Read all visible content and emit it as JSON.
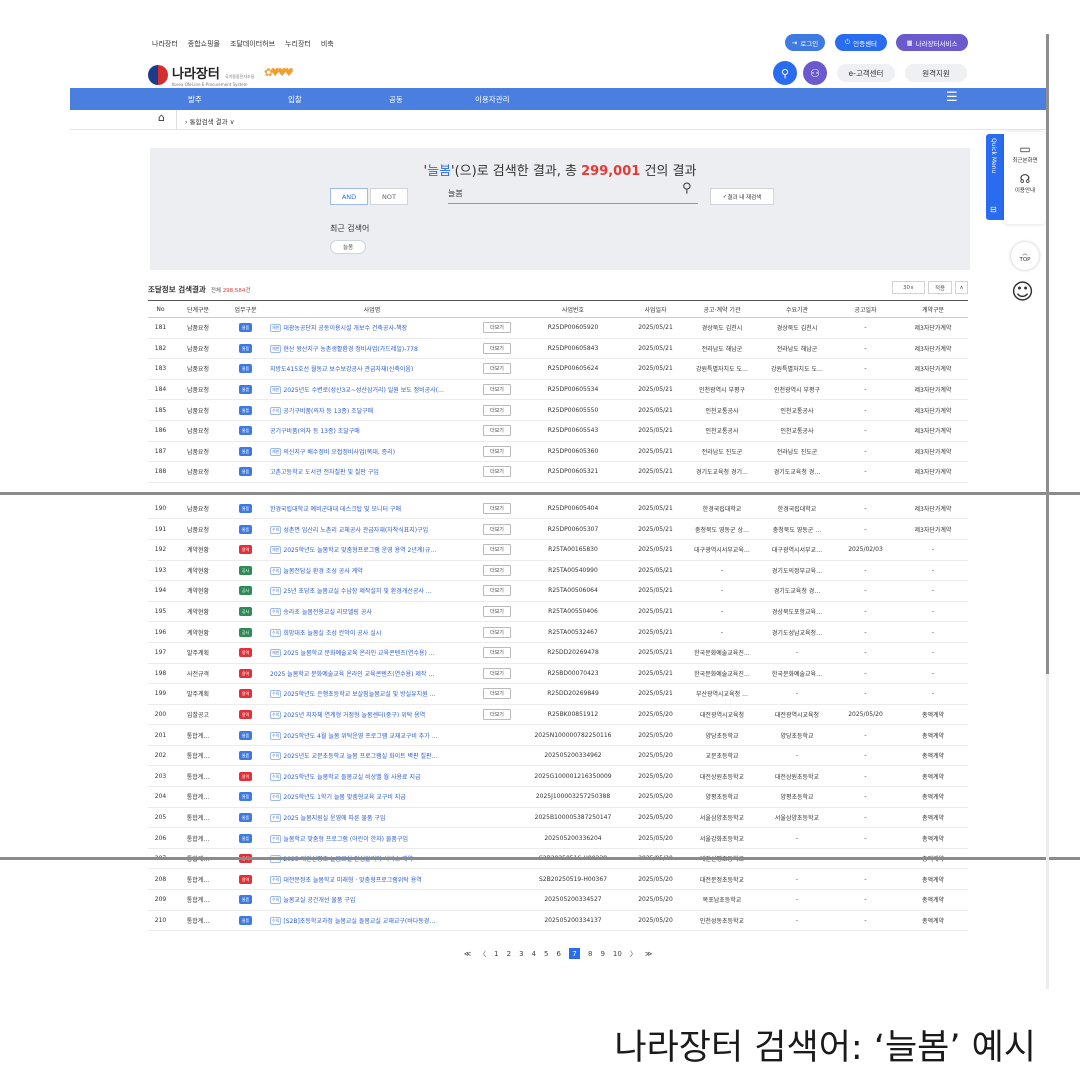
{
  "topbar": {
    "menu": [
      "나라장터",
      "종합쇼핑몰",
      "조달데이터허브",
      "누리장터",
      "비축"
    ],
    "login": "로그인",
    "cert_center": "인증센터",
    "services": "나라장터서비스"
  },
  "header": {
    "logo_title": "나라장터",
    "logo_sub_ko": "국가종합전자조달",
    "logo_sub_en": "Korea ON-Line E-Procurement System",
    "customer_center": "e-고객센터",
    "remote_support": "원격지원"
  },
  "nav": {
    "items": [
      "발주",
      "입찰",
      "공동",
      "이용자관리"
    ],
    "menu_icon": "hamburger-icon"
  },
  "breadcrumb": {
    "current": "통합검색 결과"
  },
  "search": {
    "title_prefix": "'",
    "keyword": "늘봄",
    "title_mid": "'(으)로 검색한 결과, 총",
    "total": "299,001",
    "title_suffix": "건의 결과",
    "and_label": "AND",
    "not_label": "NOT",
    "input_value": "늘봄",
    "research_label": "결과 내 재검색",
    "recent_label": "최근 검색어",
    "recent_chip": "늘봄"
  },
  "results": {
    "title": "조달정보 검색결과",
    "count_prefix": "전체",
    "count": "298,584",
    "count_suffix": "건",
    "per_page": "30",
    "apply": "적용",
    "columns": [
      "No",
      "단계구분",
      "업무구분",
      "사업명",
      "",
      "사업번호",
      "사업일자",
      "공고·계약 기관",
      "수요기관",
      "공고일자",
      "계약구분"
    ],
    "view_label": "더보기",
    "rows": [
      {
        "no": "181",
        "stage": "납품요청",
        "type": "물품",
        "tag": "재판",
        "name": "대광농공단지 공동이용시설 개보수 건축공사-책장",
        "view": true,
        "num": "R25DP00605920",
        "date": "2025/05/21",
        "org1": "경상북도 김천시",
        "org2": "경상북도 김천시",
        "pub": "-",
        "contract": "제3자단가계약"
      },
      {
        "no": "182",
        "stage": "납품요청",
        "type": "물품",
        "tag": "재판",
        "name": "현산 왕산지구 농촌생활환경 정비사업(가드레일)-778",
        "view": true,
        "num": "R25DP00605843",
        "date": "2025/05/21",
        "org1": "전라남도 해남군",
        "org2": "전라남도 해남군",
        "pub": "-",
        "contract": "제3자단가계약"
      },
      {
        "no": "183",
        "stage": "납품요청",
        "type": "물품",
        "tag": "",
        "name": "지방도415호선 월동교 보수보강공사 관급자재(신축이음)",
        "view": true,
        "num": "R25DP00605624",
        "date": "2025/05/21",
        "org1": "강원특별자치도 도…",
        "org2": "강원특별자치도 도…",
        "pub": "-",
        "contract": "제3자단가계약"
      },
      {
        "no": "184",
        "stage": "납품요청",
        "type": "물품",
        "tag": "재판",
        "name": "2025년도 수변로(성산3교~성산삼거리) 일원 보도 정비공사(…",
        "view": true,
        "num": "R25DP00605534",
        "date": "2025/05/21",
        "org1": "인천광역시 부평구",
        "org2": "인천광역시 부평구",
        "pub": "-",
        "contract": "제3자단가계약"
      },
      {
        "no": "185",
        "stage": "납품요청",
        "type": "물품",
        "tag": "수의",
        "name": "공기구비품(의자 등 13종) 조달구매",
        "view": true,
        "num": "R25DP00605550",
        "date": "2025/05/21",
        "org1": "인천교통공사",
        "org2": "인천교통공사",
        "pub": "-",
        "contract": "제3자단가계약"
      },
      {
        "no": "186",
        "stage": "납품요청",
        "type": "물품",
        "tag": "",
        "name": "공기구비품(의자 등 13종) 조달구매",
        "view": true,
        "num": "R25DP00605543",
        "date": "2025/05/21",
        "org1": "인천교통공사",
        "org2": "인천교통공사",
        "pub": "-",
        "contract": "제3자단가계약"
      },
      {
        "no": "187",
        "stage": "납품요청",
        "type": "물품",
        "tag": "재판",
        "name": "의신지구 배수정비 오접정비사업(목대, 증리)",
        "view": true,
        "num": "R25DP00605360",
        "date": "2025/05/21",
        "org1": "전라남도 진도군",
        "org2": "전라남도 진도군",
        "pub": "-",
        "contract": "제3자단가계약"
      },
      {
        "no": "188",
        "stage": "납품요청",
        "type": "물품",
        "tag": "",
        "name": "고촌고등학교 도서관 전자칠판 및 칠판 구입",
        "view": true,
        "num": "R25DP00605321",
        "date": "2025/05/21",
        "org1": "경기도교육청 경기…",
        "org2": "경기도교육청 경…",
        "pub": "-",
        "contract": "제3자단가계약"
      }
    ],
    "rows2": [
      {
        "no": "190",
        "stage": "납품요청",
        "type": "물품",
        "tag": "",
        "name": "한경국립대학교 예비군대대 데스크탑 및 모니터 구매",
        "view": true,
        "num": "R25DP00605404",
        "date": "2025/05/21",
        "org1": "한경국립대학교",
        "org2": "한경국립대학교",
        "pub": "-",
        "contract": "제3자단가계약"
      },
      {
        "no": "191",
        "stage": "납품요청",
        "type": "물품",
        "tag": "수의",
        "name": "성촌면 임산리 노촌리 교체공사 관급자재(자착식표지)구입",
        "view": true,
        "num": "R25DP00605307",
        "date": "2025/05/21",
        "org1": "충청북도 영동군 상…",
        "org2": "충청북도 영동군 …",
        "pub": "-",
        "contract": "제3자단가계약"
      },
      {
        "no": "192",
        "stage": "계약현황",
        "type": "용역",
        "tag": "재판",
        "name": "2025학년도 늘봄학교 맞춤형프로그램 운영 용역 2년계(규…",
        "view": true,
        "num": "R25TA00165830",
        "date": "2025/05/21",
        "org1": "대구광역시서부교육…",
        "org2": "대구광역시서부교…",
        "pub": "2025/02/03",
        "contract": "-"
      },
      {
        "no": "193",
        "stage": "계약현황",
        "type": "공사",
        "tag": "수의",
        "name": "늘봄전담실 환경 조성 공사 계약",
        "view": true,
        "num": "R25TA00540990",
        "date": "2025/05/21",
        "org1": "-",
        "org2": "경기도의정부교육…",
        "pub": "-",
        "contract": "-"
      },
      {
        "no": "194",
        "stage": "계약현황",
        "type": "공사",
        "tag": "수의",
        "name": "25년 초당초 늘봄교실 수납장 제작설치 및 환경개선공사 …",
        "view": true,
        "num": "R25TA00506064",
        "date": "2025/05/21",
        "org1": "-",
        "org2": "경기도교육청 경…",
        "pub": "-",
        "contract": "-"
      },
      {
        "no": "195",
        "stage": "계약현황",
        "type": "공사",
        "tag": "수의",
        "name": "송라초 늘봄전용교실 리모델링 공사",
        "view": true,
        "num": "R25TA00550406",
        "date": "2025/05/21",
        "org1": "-",
        "org2": "경상북도포항교육…",
        "pub": "-",
        "contract": "-"
      },
      {
        "no": "196",
        "stage": "계약현황",
        "type": "공사",
        "tag": "수의",
        "name": "희망대초 늘봄실 조성 칸막이 공사 실시",
        "view": true,
        "num": "R25TA00532467",
        "date": "2025/05/21",
        "org1": "-",
        "org2": "경기도성남교육청…",
        "pub": "-",
        "contract": "-"
      },
      {
        "no": "197",
        "stage": "발주계획",
        "type": "용역",
        "tag": "재판",
        "name": "2025 늘봄학교 문화예술교육 온라인 교육콘텐츠(연수용) …",
        "view": true,
        "num": "R25DD20269478",
        "date": "2025/05/21",
        "org1": "한국문화예술교육진…",
        "org2": "-",
        "pub": "-",
        "contract": "-"
      },
      {
        "no": "198",
        "stage": "사전규격",
        "type": "용역",
        "tag": "",
        "name": "2025 늘봄학교 문화예술교육 온라인 교육콘텐츠(연수용) 제작 …",
        "view": true,
        "num": "R25BD00070423",
        "date": "2025/05/21",
        "org1": "한국문화예술교육진…",
        "org2": "한국문화예술교육…",
        "pub": "-",
        "contract": "-"
      },
      {
        "no": "199",
        "stage": "발주계획",
        "type": "용역",
        "tag": "수의",
        "name": "2025학년도 은행초등학교 보살핌늘봄교실 및 방실유치원 …",
        "view": true,
        "num": "R25DD20269849",
        "date": "2025/05/21",
        "org1": "부산광역시교육청 …",
        "org2": "-",
        "pub": "-",
        "contract": "-"
      },
      {
        "no": "200",
        "stage": "입찰공고",
        "type": "용역",
        "tag": "수의",
        "name": "2025년 지자체 연계형 거점형 늘봄센터(중구) 위탁 용역",
        "view": true,
        "num": "R25BK00851912",
        "date": "2025/05/20",
        "org1": "대전광역시교육청",
        "org2": "대전광역시교육청",
        "pub": "2025/05/20",
        "contract": "총액계약"
      },
      {
        "no": "201",
        "stage": "통합계…",
        "type": "물품",
        "tag": "수의",
        "name": "2025학년도 4월 늘봄 위탁운영 프로그램 교재교구비 추가 …",
        "view": false,
        "num": "2025N100000782250116",
        "date": "2025/05/20",
        "org1": "양당초등학교",
        "org2": "양당초등학교",
        "pub": "-",
        "contract": "총액계약"
      },
      {
        "no": "202",
        "stage": "통합계…",
        "type": "물품",
        "tag": "수의",
        "name": "2025년도 교문초등학교 늘봄 프로그램실 화이트 벽판 칠판…",
        "view": false,
        "num": "202505200334962",
        "date": "2025/05/20",
        "org1": "교문초등학교",
        "org2": "-",
        "pub": "-",
        "contract": "총액계약"
      },
      {
        "no": "203",
        "stage": "통합계…",
        "type": "용역",
        "tag": "수의",
        "name": "2025학년도 늘봄학교 돌봄교실 비상벨 월 사용료 지급",
        "view": false,
        "num": "2025G100001216350009",
        "date": "2025/05/20",
        "org1": "대전상원초등학교",
        "org2": "대전상원초등학교",
        "pub": "-",
        "contract": "총액계약"
      },
      {
        "no": "204",
        "stage": "통합계…",
        "type": "물품",
        "tag": "수의",
        "name": "2025학년도 1학기 늘봄 맞춤형교육 교구비 지급",
        "view": false,
        "num": "2025J100003257250388",
        "date": "2025/05/20",
        "org1": "양평초등학교",
        "org2": "양평초등학교",
        "pub": "-",
        "contract": "총액계약"
      },
      {
        "no": "205",
        "stage": "통합계…",
        "type": "물품",
        "tag": "수의",
        "name": "2025 늘봄지원실 운영에 따른 물품 구입",
        "view": false,
        "num": "2025B100005387250147",
        "date": "2025/05/20",
        "org1": "서울삼양초등학교",
        "org2": "서울삼양초등학교",
        "pub": "-",
        "contract": "총액계약"
      },
      {
        "no": "206",
        "stage": "통합계…",
        "type": "물품",
        "tag": "수의",
        "name": "늘봄학교 맞춤형 프로그램 (어린이 한자) 물품구입",
        "view": false,
        "num": "202505200336204",
        "date": "2025/05/20",
        "org1": "서울강화초등학교",
        "org2": "-",
        "pub": "-",
        "contract": "총액계약"
      }
    ],
    "rows3": [
      {
        "no": "207",
        "stage": "통합계…",
        "type": "용역",
        "tag": "수의",
        "name": "2025 대전신평초 늘봄교실 안심알리미 서비스 계약",
        "view": false,
        "num": "S2B20250516-H00238",
        "date": "2025/05/20",
        "org1": "대전신평초등학교",
        "org2": "-",
        "pub": "-",
        "contract": "총액계약"
      },
      {
        "no": "208",
        "stage": "통합계…",
        "type": "용역",
        "tag": "수의",
        "name": "대전문정초 늘봄학교 미래형 · 맞춤형프로그램위탁 용역",
        "view": false,
        "num": "S2B20250519-H00367",
        "date": "2025/05/20",
        "org1": "대전문정초등학교",
        "org2": "-",
        "pub": "-",
        "contract": "총액계약"
      },
      {
        "no": "209",
        "stage": "통합계…",
        "type": "물품",
        "tag": "수의",
        "name": "늘봄교실 공간개선 물품 구입",
        "view": false,
        "num": "202505200334527",
        "date": "2025/05/20",
        "org1": "목포남초등학교",
        "org2": "-",
        "pub": "-",
        "contract": "총액계약"
      },
      {
        "no": "210",
        "stage": "통합계…",
        "type": "물품",
        "tag": "수의",
        "name": "[S2B]초등학교과정 늘봄교실 돌봄교실 교재교구(바다동경…",
        "view": false,
        "num": "202505200334137",
        "date": "2025/05/20",
        "org1": "인천성동초등학교",
        "org2": "-",
        "pub": "-",
        "contract": "총액계약"
      }
    ]
  },
  "pagination": {
    "first": "≪",
    "prev": "〈",
    "pages": [
      "1",
      "2",
      "3",
      "4",
      "5",
      "6",
      "7",
      "8",
      "9",
      "10"
    ],
    "current": "7",
    "next": "〉",
    "last": "≫"
  },
  "quick_menu": {
    "label": "Quick Menu",
    "recent_screen": "최근본화면",
    "guide": "이용안내",
    "top": "TOP"
  },
  "colors": {
    "primary": "#4a7fe0",
    "red": "#e53935",
    "blue_button": "#2a6cf0",
    "goods": "#3f7ae0",
    "service": "#e0303a",
    "construction": "#2e8b57"
  },
  "caption": "나라장터 검색어: ‘늘봄’ 예시"
}
